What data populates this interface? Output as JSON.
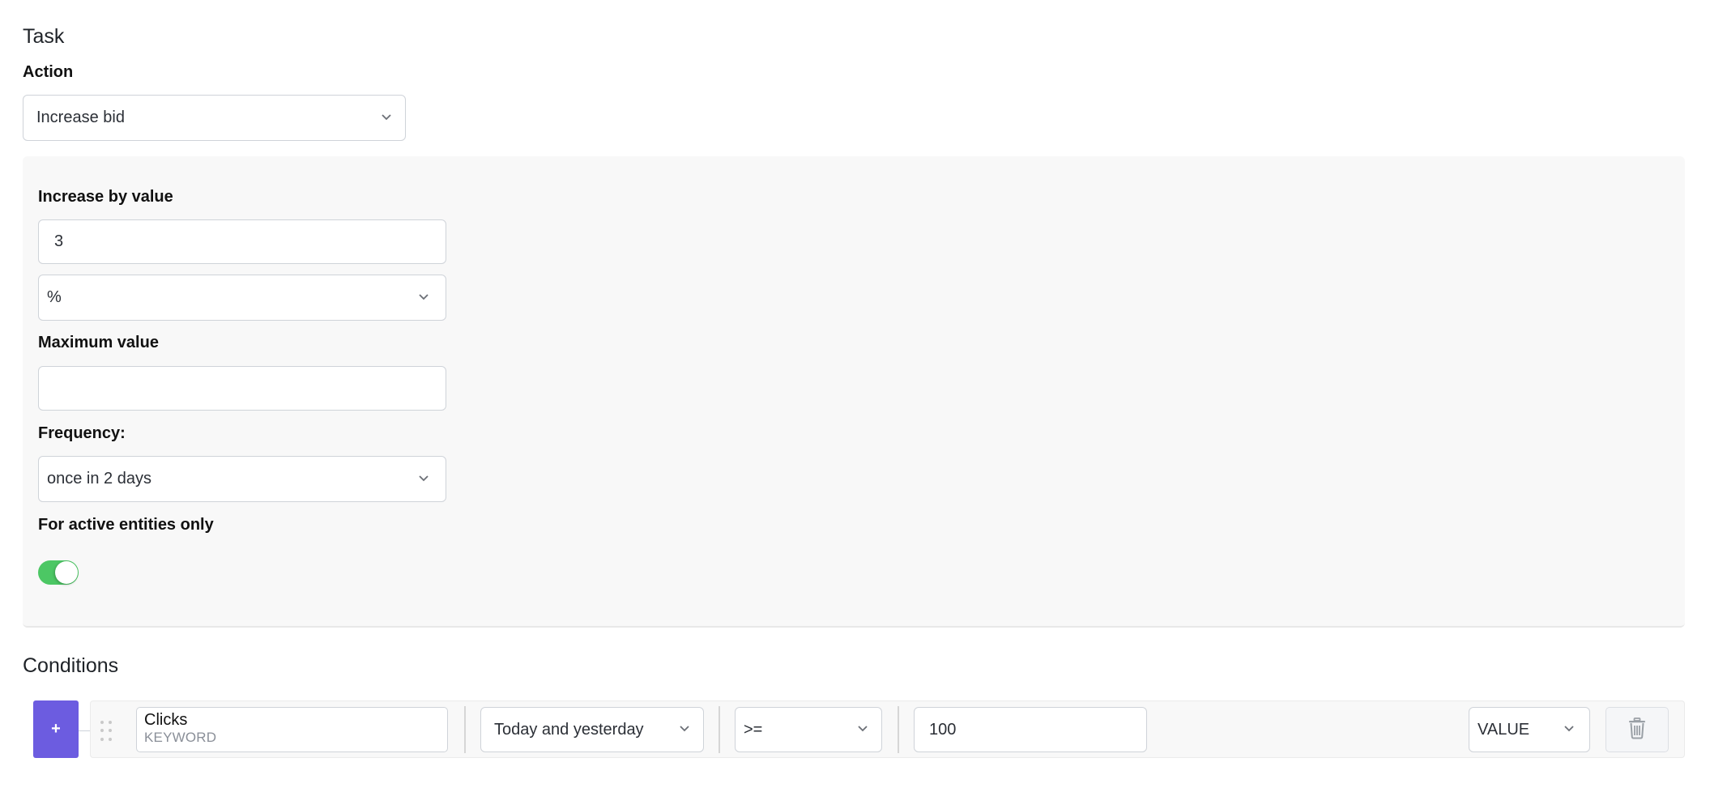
{
  "task": {
    "title": "Task",
    "action_label": "Action",
    "action_value": "Increase bid"
  },
  "settings": {
    "increase_label": "Increase by value",
    "increase_value": "3",
    "unit_value": "%",
    "max_label": "Maximum value",
    "max_value": "",
    "frequency_label": "Frequency:",
    "frequency_value": "once in 2 days",
    "active_only_label": "For active entities only",
    "active_only_enabled": true,
    "toggle_color": "#4cc764"
  },
  "conditions": {
    "title": "Conditions",
    "add_button_label": "+",
    "add_button_color": "#6c5ce0",
    "rows": [
      {
        "metric": "Clicks",
        "entity": "KEYWORD",
        "period": "Today and yesterday",
        "operator": ">=",
        "value": "100",
        "value_type": "VALUE"
      }
    ]
  }
}
